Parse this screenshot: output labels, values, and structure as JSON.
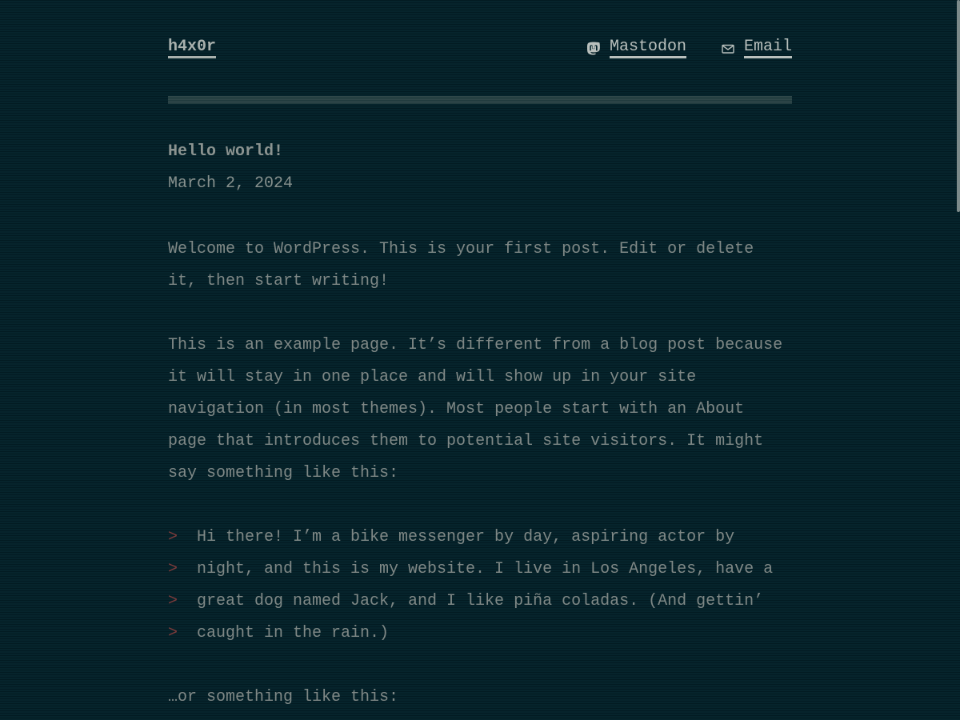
{
  "site": {
    "title": "h4x0r"
  },
  "social": [
    {
      "icon": "mastodon-icon",
      "label": "Mastodon"
    },
    {
      "icon": "email-icon",
      "label": "Email"
    }
  ],
  "post": {
    "title": "Hello world!",
    "date": "March 2, 2024",
    "paragraph1": "Welcome to WordPress. This is your first post. Edit or delete it, then start writing!",
    "paragraph2": "This is an example page. It’s different from a blog post because it will stay in one place and will show up in your site navigation (in most themes). Most people start with an About page that introduces them to potential site visitors. It might say something like this:",
    "quote_marker": ">",
    "quote": "Hi there! I’m a bike messenger by day, aspiring actor by night, and this is my website. I live in Los Angeles, have a great dog named Jack, and I like piña coladas. (And gettin’ caught in the rain.)",
    "paragraph3": "…or something like this:"
  },
  "colors": {
    "background": "#022129",
    "text": "#7f8886",
    "link": "#b9c0bd",
    "quote": "#b3302e"
  }
}
